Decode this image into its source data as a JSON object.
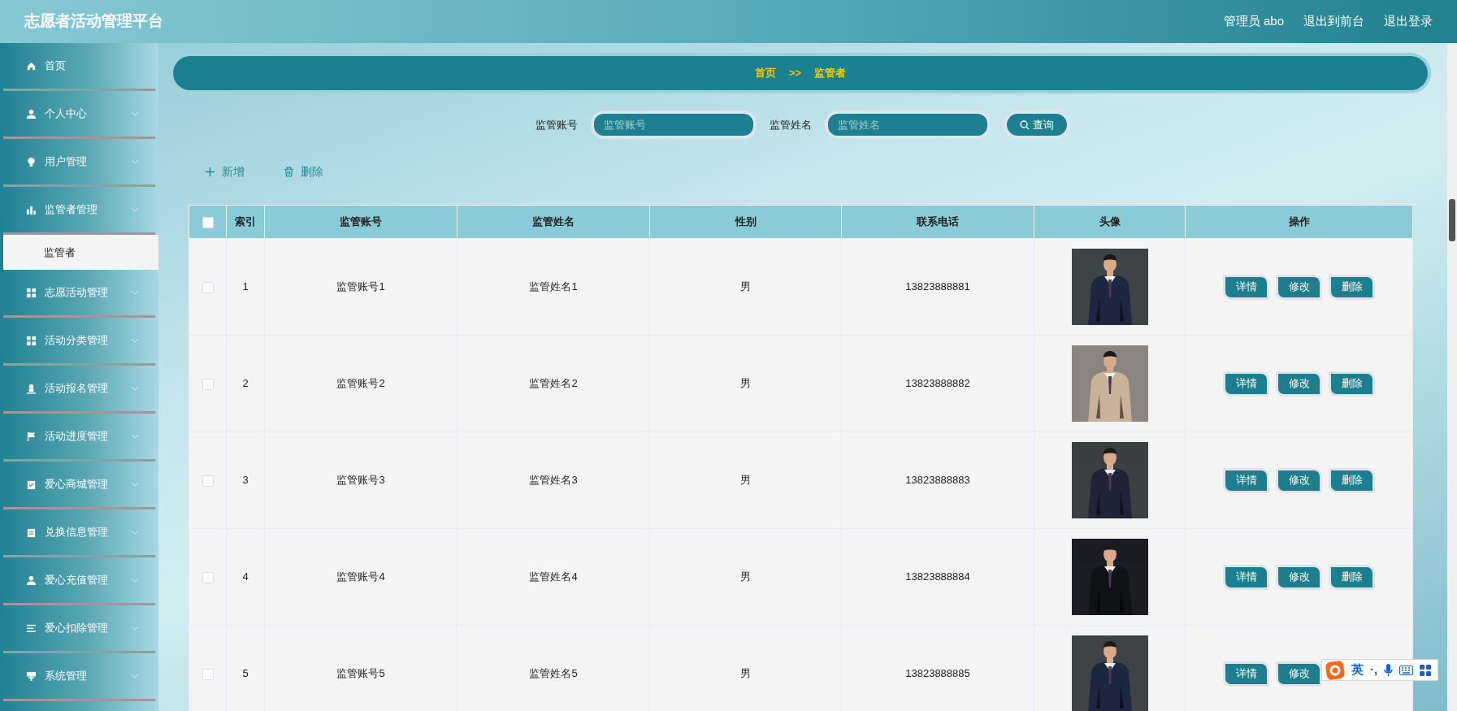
{
  "header": {
    "title": "志愿者活动管理平台",
    "links": [
      "管理员 abo",
      "退出到前台",
      "退出登录"
    ]
  },
  "sidebar": {
    "items": [
      {
        "label": "首页",
        "expandable": false,
        "selected": false
      },
      {
        "label": "个人中心",
        "expandable": true,
        "selected": false
      },
      {
        "label": "用户管理",
        "expandable": true,
        "selected": false
      },
      {
        "label": "监管者管理",
        "expandable": true,
        "selected": false,
        "children": [
          {
            "label": "监管者",
            "selected": true
          }
        ]
      },
      {
        "label": "志愿活动管理",
        "expandable": true,
        "selected": false
      },
      {
        "label": "活动分类管理",
        "expandable": true,
        "selected": false
      },
      {
        "label": "活动报名管理",
        "expandable": true,
        "selected": false
      },
      {
        "label": "活动进度管理",
        "expandable": true,
        "selected": false
      },
      {
        "label": "爱心商城管理",
        "expandable": true,
        "selected": false
      },
      {
        "label": "兑换信息管理",
        "expandable": true,
        "selected": false
      },
      {
        "label": "爱心充值管理",
        "expandable": true,
        "selected": false
      },
      {
        "label": "爱心扣除管理",
        "expandable": true,
        "selected": false
      },
      {
        "label": "系统管理",
        "expandable": true,
        "selected": false
      }
    ]
  },
  "breadcrumb": {
    "items": [
      "首页",
      "监管者"
    ],
    "separator": ">>"
  },
  "search": {
    "fields": [
      {
        "label": "监管账号",
        "placeholder": "监管账号"
      },
      {
        "label": "监管姓名",
        "placeholder": "监管姓名"
      }
    ],
    "button": "查询"
  },
  "toolbar": [
    {
      "kind": "add",
      "label": "新增"
    },
    {
      "kind": "delete",
      "label": "删除"
    }
  ],
  "table": {
    "select_all_checked": false,
    "columns": [
      "索引",
      "监管账号",
      "监管姓名",
      "性别",
      "联系电话",
      "头像",
      "操作"
    ],
    "rows": [
      {
        "checked": false,
        "index": "1",
        "account": "监管账号1",
        "name": "监管姓名1",
        "gender": "男",
        "phone": "13823888881",
        "avatar": {
          "kind": "picture"
        },
        "actions": [
          "详情",
          "修改",
          "删除"
        ]
      },
      {
        "checked": false,
        "index": "2",
        "account": "监管账号2",
        "name": "监管姓名2",
        "gender": "男",
        "phone": "13823888882",
        "avatar": {
          "kind": "picture"
        },
        "actions": [
          "详情",
          "修改",
          "删除"
        ]
      },
      {
        "checked": false,
        "index": "3",
        "account": "监管账号3",
        "name": "监管姓名3",
        "gender": "男",
        "phone": "13823888883",
        "avatar": {
          "kind": "picture"
        },
        "actions": [
          "详情",
          "修改",
          "删除"
        ]
      },
      {
        "checked": false,
        "index": "4",
        "account": "监管账号4",
        "name": "监管姓名4",
        "gender": "男",
        "phone": "13823888884",
        "avatar": {
          "kind": "picture"
        },
        "actions": [
          "详情",
          "修改",
          "删除"
        ]
      },
      {
        "checked": false,
        "index": "5",
        "account": "监管账号5",
        "name": "监管姓名5",
        "gender": "男",
        "phone": "13823888885",
        "avatar": {
          "kind": "picture"
        },
        "actions": [
          "详情",
          "修改"
        ]
      }
    ]
  },
  "ime_toolbar": {
    "mode": "英",
    "punctuation": "·,"
  }
}
